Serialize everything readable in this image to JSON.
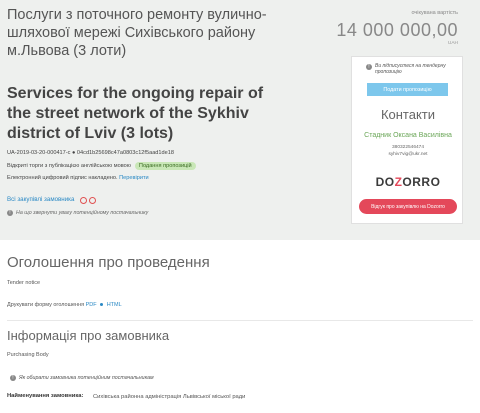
{
  "tender": {
    "title_ua": "Послуги з поточного ремонту вулично-шляхової мережі Сихівського району м.Львова (3 лоти)",
    "title_en": "Services for the ongoing repair of the street network of the Sykhiv district of Lviv (3 lots)",
    "id_line": "UA-2019-03-20-000417-c ● 04cd1b25698c47a0803c12f5aad1de18",
    "open_bidding": "Відкриті торги з публікацією англійською мовою",
    "status_badge": "Подання пропозицій",
    "signature_text": "Електронний цифровий підпис накладено.",
    "signature_link": "Перевірити",
    "all_purchases_link": "Всі закупівлі замовника",
    "attention_note": "На що звернути увагу потенційному постачальнику"
  },
  "value": {
    "label": "очікувана вартість",
    "amount": "14 000 000,00",
    "currency": "UAH"
  },
  "side_card": {
    "subscribe_note": "Ви підписуєтеся на тендерну пропозицію",
    "submit_button": "Подати пропозицію",
    "contacts_title": "Контакти",
    "contact_name": "Стадник Оксана Василівна",
    "contact_phone": "380322546474",
    "contact_email": "syhiv7vig@ukr.net",
    "dozorro_logo": "DOZORRO",
    "review_button": "Відгук про закупівлю на Dozorro"
  },
  "announcement": {
    "heading": "Оголошення про проведення",
    "heading_en": "Tender notice",
    "print_label": "Друкувати форму оголошення",
    "print_pdf": "PDF",
    "print_html": "HTML"
  },
  "customer": {
    "heading": "Інформація про замовника",
    "heading_en": "Purchasing Body",
    "potential_supplier_note": "Як обирати замовника потенційним постачальникам",
    "name_label": "Найменування замовника:",
    "name_value": "Сихівська районна адміністрація Львівської міської ради"
  },
  "colors": {
    "hero_bg": "#eef0ee",
    "link": "#2a89c5",
    "badge_bg": "#c9e7b7",
    "submit_btn": "#7dc7ec",
    "contact_name": "#6aa657",
    "review_btn": "#e4485a"
  }
}
